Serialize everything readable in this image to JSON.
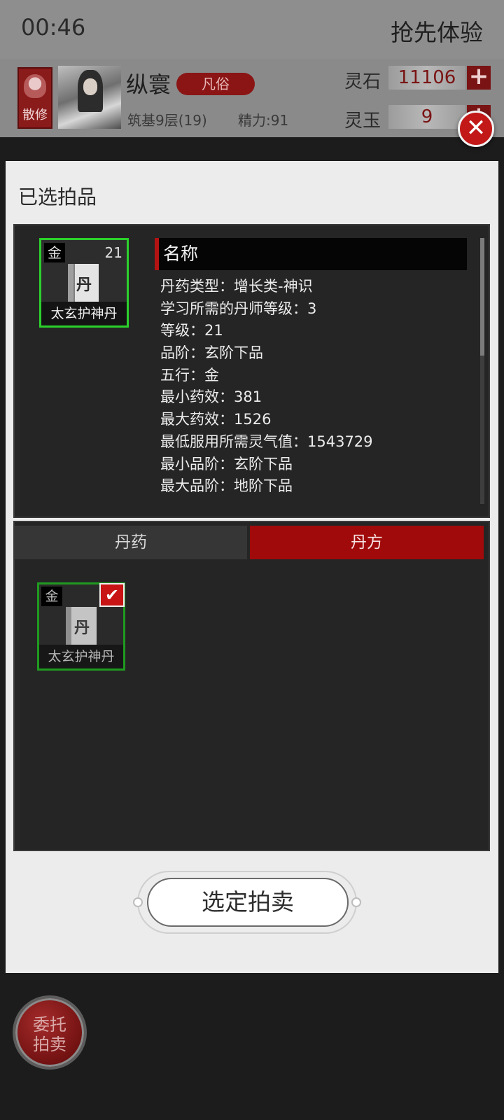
{
  "status_bar": {
    "time": "00:46",
    "early_access": "抢先体验"
  },
  "player": {
    "sect_label": "散修",
    "name": "纵寰",
    "rank": "凡俗",
    "cultivation": "筑基9层(19)",
    "energy": "精力:91"
  },
  "currencies": [
    {
      "label": "灵石",
      "value": "11106"
    },
    {
      "label": "灵玉",
      "value": "9"
    }
  ],
  "modal": {
    "title": "已选拍品",
    "selected_item": {
      "element": "金",
      "level": "21",
      "glyph": "丹",
      "name": "太玄护神丹"
    },
    "info_header": "名称",
    "info_lines": [
      "丹药类型：增长类-神识",
      "学习所需的丹师等级：3",
      "等级：21",
      "品阶：玄阶下品",
      "五行：金",
      "最小药效：381",
      "最大药效：1526",
      "最低服用所需灵气值：1543729",
      "最小品阶：玄阶下品",
      "最大品阶：地阶下品"
    ],
    "tabs": {
      "pills": "丹药",
      "recipes": "丹方"
    },
    "list_items": [
      {
        "element": "金",
        "glyph": "丹",
        "name": "太玄护神丹",
        "checked": true
      }
    ],
    "confirm_label": "选定拍卖"
  },
  "consign_button": {
    "line1": "委托",
    "line2": "拍卖"
  },
  "colors": {
    "accent_red": "#a10a0a",
    "selection_green": "#2bd12b",
    "panel_dark": "#252525"
  }
}
